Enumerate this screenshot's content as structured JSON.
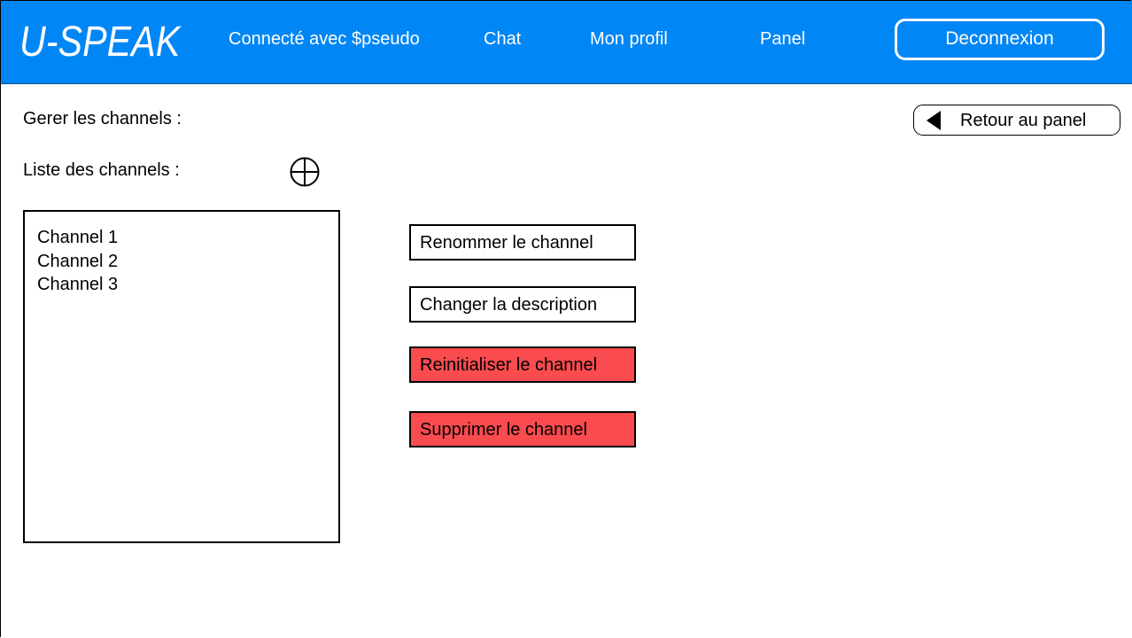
{
  "header": {
    "logo": "U-SPEAK",
    "connected_text": "Connecté avec $pseudo",
    "nav": {
      "chat": "Chat",
      "profile": "Mon profil",
      "panel": "Panel"
    },
    "logout_label": "Deconnexion",
    "background_color": "#0086f5"
  },
  "page": {
    "manage_label": "Gerer les channels :",
    "list_label": "Liste des channels :",
    "back_label": "Retour au panel",
    "add_icon": "plus-circle-icon",
    "back_icon": "triangle-left-icon"
  },
  "channels": [
    "Channel 1",
    "Channel 2",
    "Channel 3"
  ],
  "actions": {
    "rename": "Renommer le channel",
    "change_description": "Changer la description",
    "reset": "Reinitialiser le channel",
    "delete": "Supprimer le channel",
    "danger_color": "#fa4b4f"
  }
}
